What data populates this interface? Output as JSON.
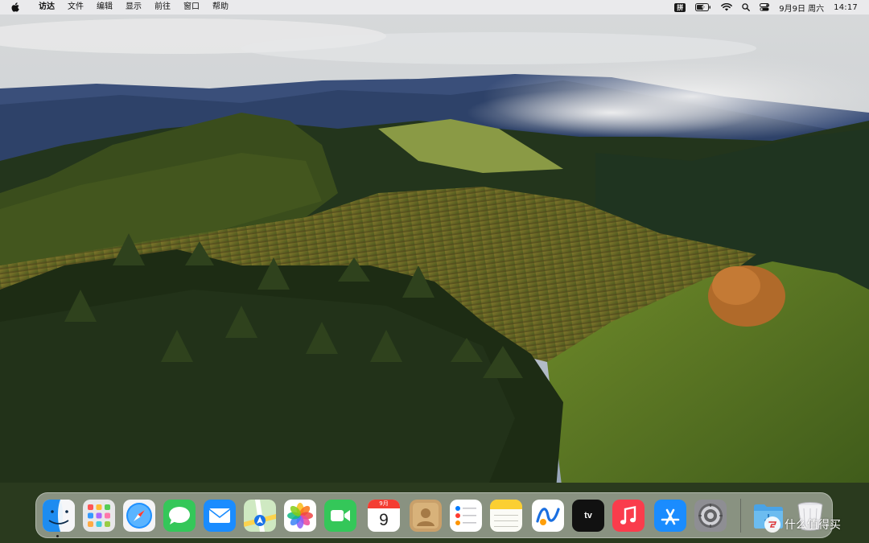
{
  "menubar": {
    "apple_icon": "apple-logo-icon",
    "app_name": "访达",
    "items": [
      "文件",
      "编辑",
      "显示",
      "前往",
      "窗口",
      "帮助"
    ],
    "status": {
      "input_method": "拼",
      "battery_icon": "battery-charging-icon",
      "wifi_icon": "wifi-icon",
      "search_icon": "spotlight-search-icon",
      "control_center_icon": "control-center-icon",
      "date": "9月9日 周六",
      "time": "14:17"
    }
  },
  "dock": {
    "apps": [
      {
        "name": "finder",
        "icon": "finder-icon",
        "running": true
      },
      {
        "name": "launchpad",
        "icon": "launchpad-icon"
      },
      {
        "name": "safari",
        "icon": "safari-icon"
      },
      {
        "name": "messages",
        "icon": "messages-icon"
      },
      {
        "name": "mail",
        "icon": "mail-icon"
      },
      {
        "name": "maps",
        "icon": "maps-icon"
      },
      {
        "name": "photos",
        "icon": "photos-icon"
      },
      {
        "name": "facetime",
        "icon": "facetime-icon"
      },
      {
        "name": "calendar",
        "icon": "calendar-icon",
        "month": "9月",
        "day": "9"
      },
      {
        "name": "contacts",
        "icon": "contacts-icon"
      },
      {
        "name": "reminders",
        "icon": "reminders-icon"
      },
      {
        "name": "notes",
        "icon": "notes-icon"
      },
      {
        "name": "freeform",
        "icon": "freeform-icon"
      },
      {
        "name": "tv",
        "icon": "apple-tv-icon",
        "label": "tv"
      },
      {
        "name": "music",
        "icon": "music-icon"
      },
      {
        "name": "app-store",
        "icon": "app-store-icon"
      },
      {
        "name": "system-settings",
        "icon": "system-settings-icon"
      }
    ],
    "right": [
      {
        "name": "downloads-folder",
        "icon": "downloads-folder-icon"
      },
      {
        "name": "trash",
        "icon": "trash-icon"
      }
    ]
  },
  "watermark": {
    "text": "什么值得买",
    "icon": "smzdm-logo-icon"
  },
  "colors": {
    "menubar_bg": "#ebebee",
    "calendar_red": "#f43d32",
    "messages_green": "#34c759",
    "music_red": "#fa3c4c"
  }
}
